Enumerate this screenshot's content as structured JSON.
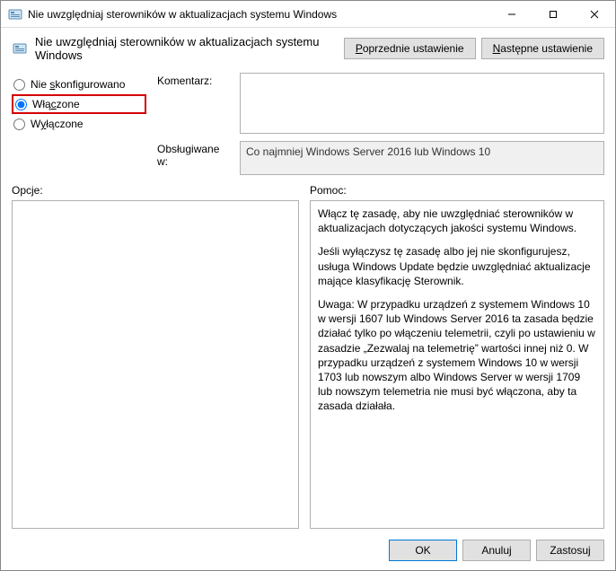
{
  "window": {
    "title": "Nie uwzględniaj sterowników w aktualizacjach systemu Windows"
  },
  "header": {
    "text": "Nie uwzględniaj sterowników w aktualizacjach systemu Windows",
    "prev_label": "Poprzednie ustawienie",
    "prev_underline": "P",
    "next_label": "Następne ustawienie",
    "next_underline": "N"
  },
  "radio": {
    "not_configured": {
      "char": "s",
      "before": "Nie ",
      "after": "konfigurowano"
    },
    "enabled": {
      "char": "c",
      "before": "Włą",
      "after": "zone"
    },
    "disabled": {
      "char": "y",
      "before": "W",
      "after": "łączone"
    },
    "selected": "enabled"
  },
  "fields": {
    "comment_label": "Komentarz:",
    "comment_value": "",
    "supported_label": "Obsługiwane w:",
    "supported_value": "Co najmniej Windows Server 2016 lub Windows 10"
  },
  "sections": {
    "options_label": "Opcje:",
    "help_label": "Pomoc:"
  },
  "help": {
    "p1": "Włącz tę zasadę, aby nie uwzględniać sterowników w aktualizacjach dotyczących jakości systemu Windows.",
    "p2": "Jeśli wyłączysz tę zasadę albo jej nie skonfigurujesz, usługa Windows Update będzie uwzględniać aktualizacje mające klasyfikację Sterownik.",
    "p3": "Uwaga: W przypadku urządzeń z systemem Windows 10 w wersji 1607 lub Windows Server 2016 ta zasada będzie działać tylko po włączeniu telemetrii, czyli po ustawieniu w zasadzie „Zezwalaj na telemetrię” wartości innej niż 0. W przypadku urządzeń z systemem Windows 10 w wersji 1703 lub nowszym albo Windows Server w wersji 1709 lub nowszym telemetria nie musi być włączona, aby ta zasada działała."
  },
  "footer": {
    "ok": "OK",
    "cancel": "Anuluj",
    "apply": "Zastosuj"
  }
}
